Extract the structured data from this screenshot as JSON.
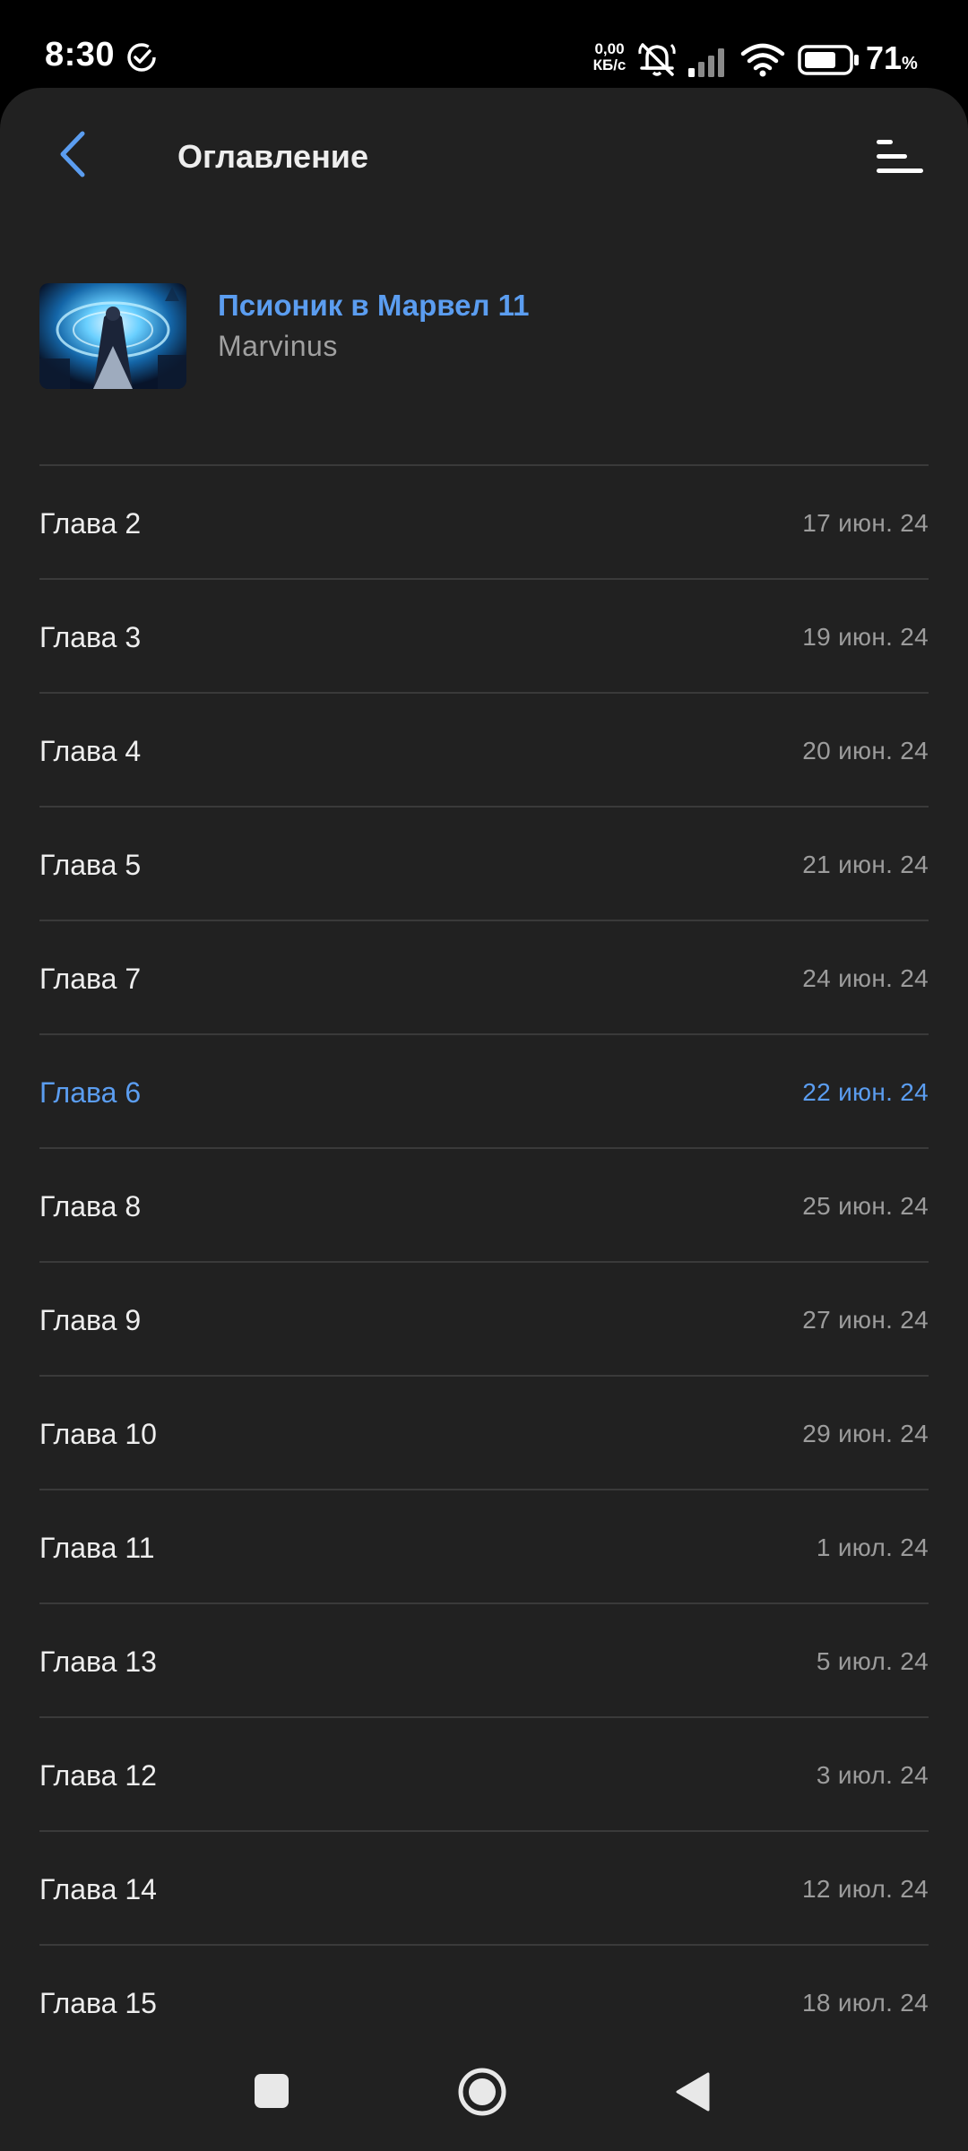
{
  "status": {
    "time": "8:30",
    "net_speed_value": "0,00",
    "net_speed_unit": "КБ/с",
    "battery": "71",
    "battery_unit": "%"
  },
  "header": {
    "title": "Оглавление"
  },
  "book": {
    "title": "Псионик в Марвел 11",
    "author": "Marvinus"
  },
  "colors": {
    "accent": "#5b9df0",
    "background": "#212121"
  },
  "chapters": [
    {
      "title": "Глава 2",
      "date": "17 июн. 24"
    },
    {
      "title": "Глава 3",
      "date": "19 июн. 24"
    },
    {
      "title": "Глава 4",
      "date": "20 июн. 24"
    },
    {
      "title": "Глава 5",
      "date": "21 июн. 24"
    },
    {
      "title": "Глава 7",
      "date": "24 июн. 24"
    },
    {
      "title": "Глава 6",
      "date": "22 июн. 24",
      "current": true
    },
    {
      "title": "Глава 8",
      "date": "25 июн. 24"
    },
    {
      "title": "Глава 9",
      "date": "27 июн. 24"
    },
    {
      "title": "Глава 10",
      "date": "29 июн. 24"
    },
    {
      "title": "Глава 11",
      "date": "1 июл. 24"
    },
    {
      "title": "Глава 13",
      "date": "5 июл. 24"
    },
    {
      "title": "Глава 12",
      "date": "3 июл. 24"
    },
    {
      "title": "Глава 14",
      "date": "12 июл. 24"
    },
    {
      "title": "Глава 15",
      "date": "18 июл. 24"
    }
  ]
}
